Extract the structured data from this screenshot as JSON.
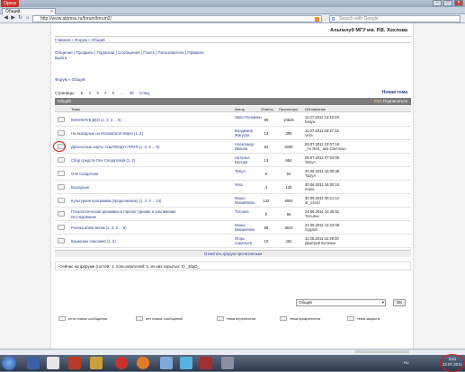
{
  "browser": {
    "menu_label": "Opera",
    "tab_title": "Общий",
    "url": "http://www.alpmsu.ru/forum/forum2/",
    "search_placeholder": "Search with Google",
    "window_controls": [
      "–",
      "□",
      "×"
    ]
  },
  "site": {
    "title": "Альпклуб МГУ им. Р.В. Хохлова",
    "breadcrumb_top": "Главная » Форум » Общий",
    "nav_line1": "Общение  |  Профиль  |  Подписки  |  Сообщения  |  Поиск  |  Пользователи  |  Правила",
    "nav_line2": "Выйти",
    "breadcrumb": "Форум » Общий"
  },
  "pager": {
    "label": "Страницы:",
    "pages": [
      "1",
      "2",
      "3",
      "4",
      "5",
      "...",
      "30",
      "След."
    ],
    "current": "1",
    "new_topic": "Новая тема"
  },
  "category": {
    "name": "Общий",
    "rss": "RSS",
    "subscribe": "Подписаться"
  },
  "columns": {
    "topic": "Темы",
    "author": "Автор",
    "replies": "Ответы",
    "views": "Просмотры",
    "updated": "Обновление"
  },
  "topics": [
    {
      "title": "КИНОКЛУБ ДКО (1, 2, 3 ... 9)",
      "title2": "",
      "author": "Иван Полевкин",
      "replies": "86",
      "views": "10525",
      "upd_date": "11.07.2011 13:10:49",
      "upd_by": "batiya"
    },
    {
      "title": "На выходные на Московское Море! (1, 2)",
      "title2": "",
      "author": "Владимир Жигусов",
      "replies": "14",
      "views": "395",
      "upd_date": "11.07.2011 18:27:32",
      "upd_by": "Vera"
    },
    {
      "title": "Дисконтные карты АЛЬПИНДУСТРИЯ (1, 2, 3 ... 9)",
      "title2": "",
      "author": "Александр Иванов",
      "replies": "83",
      "views": "2096",
      "upd_date": "06.07.2011 22:07:16",
      "upd_by": "_mr Red_ aka Светлеко"
    },
    {
      "title": "Сбор средств Оле Солдатовой (1, 2)",
      "title2": "",
      "author": "Наталья Белова",
      "replies": "13",
      "views": "654",
      "upd_date": "05.07.2011 07:02:05",
      "upd_by": "TaSyA"
    },
    {
      "title": "Оля Солдатова",
      "title2": "",
      "author": "TaSyA",
      "replies": "0",
      "views": "94",
      "upd_date": "30.06.2011 16:00:39",
      "upd_by": "TaSyA"
    },
    {
      "title": "Выходные",
      "title2": "",
      "author": "Vera",
      "replies": "3",
      "views": "125",
      "upd_date": "30.06.2011 16:00:15",
      "upd_by": "maira"
    },
    {
      "title": "Культурная программа (продолжение) (1, 2, 3 ... 14)",
      "title2": "",
      "author": "Маша Михайлова",
      "replies": "132",
      "views": "4692",
      "upd_date": "30.06.2011 00:21:12",
      "upd_by": "dr_ozerd"
    },
    {
      "title": "Психологическая динамика в горном туризме и альпинизме",
      "title2": "Исследование",
      "author": "Татьяна",
      "replies": "0",
      "views": "65",
      "upd_date": "24.06.2011 21:45:51",
      "upd_by": "Татьяна"
    },
    {
      "title": "Ролики и/или велик (1, 2, 3 ... 9)",
      "title2": "",
      "author": "Маша Михайлова",
      "replies": "86",
      "views": "3642",
      "upd_date": "24.06.2011 14:23:08",
      "upd_by": "Sygatin"
    },
    {
      "title": "Крымские описания (1, 2)",
      "title2": "",
      "author": "Игорь Савельев",
      "replies": "10",
      "views": "462",
      "upd_date": "11.05.2011 12:29:00",
      "upd_by": "Дмитрий Ботавин"
    }
  ],
  "mark_read": "Отметить форум прочитанным",
  "online": "Сейчас на форуме (гостей: 1, пользователей: 1, из них скрытых: 0) _ElgO_",
  "jump": {
    "selected": "Общий",
    "go": "OK"
  },
  "legend": [
    "есть новые сообщения",
    "нет новых сообщений",
    "тема перенесена",
    "тема прикреплена",
    "тема закрыта"
  ],
  "taskbar": {
    "lang": "RU",
    "time": "3:51",
    "date": "12.07.2011"
  }
}
